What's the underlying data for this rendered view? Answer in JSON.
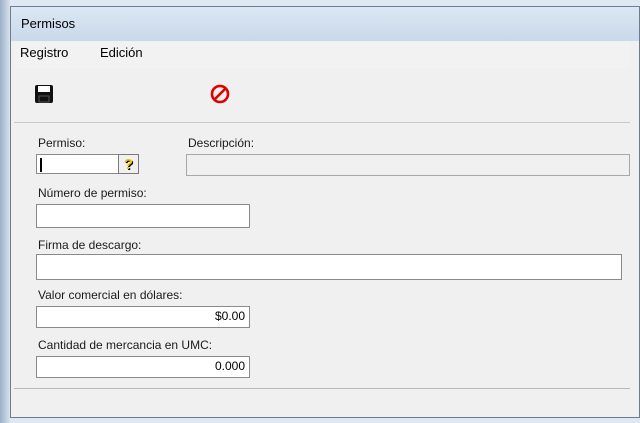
{
  "window": {
    "title": "Permisos"
  },
  "menu": {
    "items": [
      "Registro",
      "Edición"
    ]
  },
  "toolbar": {
    "save_icon": "floppy-disk-icon",
    "cancel_icon": "prohibited-icon",
    "cancel_color": "#e00000"
  },
  "form": {
    "permiso": {
      "label": "Permiso:",
      "value": ""
    },
    "descripcion": {
      "label": "Descripción:",
      "value": ""
    },
    "numero_permiso": {
      "label": "Número de permiso:",
      "value": ""
    },
    "firma_descargo": {
      "label": "Firma de descargo:",
      "value": ""
    },
    "valor_comercial": {
      "label": "Valor comercial en dólares:",
      "value": "$0.00"
    },
    "cantidad_umc": {
      "label": "Cantidad de mercancia en UMC:",
      "value": "0.000"
    },
    "help_symbol": "?"
  }
}
